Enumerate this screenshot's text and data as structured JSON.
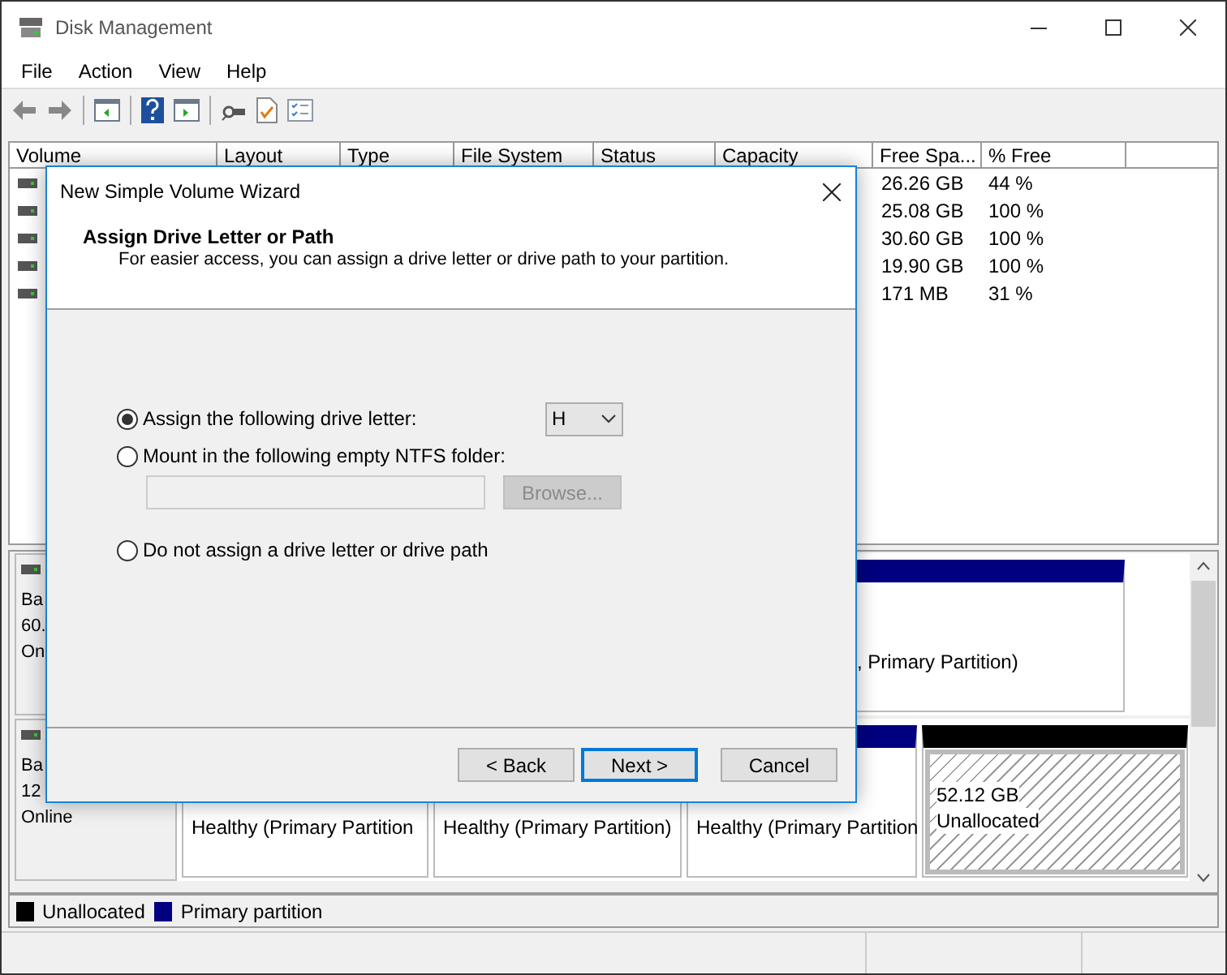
{
  "window": {
    "title": "Disk Management"
  },
  "menu": [
    "File",
    "Action",
    "View",
    "Help"
  ],
  "volume_table": {
    "columns": [
      "Volume",
      "Layout",
      "Type",
      "File System",
      "Status",
      "Capacity",
      "Free Spa...",
      "% Free"
    ],
    "rows": [
      {
        "free_space": "26.26 GB",
        "percent_free": "44 %"
      },
      {
        "free_space": "25.08 GB",
        "percent_free": "100 %"
      },
      {
        "free_space": "30.60 GB",
        "percent_free": "100 %"
      },
      {
        "free_space": "19.90 GB",
        "percent_free": "100 %"
      },
      {
        "free_space": "171 MB",
        "percent_free": "31 %"
      }
    ]
  },
  "disks": [
    {
      "label_lines": [
        "Ba",
        "60.",
        "On"
      ],
      "partitions": [
        {
          "kind": "primary",
          "lines": [
            ", Primary Partition)"
          ]
        }
      ]
    },
    {
      "label_lines": [
        "Ba",
        "12",
        "Online"
      ],
      "partitions": [
        {
          "kind": "primary",
          "lines": [
            "Healthy (Primary Partition"
          ]
        },
        {
          "kind": "primary",
          "lines": [
            "Healthy (Primary Partition)"
          ]
        },
        {
          "kind": "primary",
          "lines": [
            "Healthy (Primary Partition"
          ]
        },
        {
          "kind": "unallocated",
          "lines": [
            "52.12 GB",
            "Unallocated"
          ]
        }
      ]
    }
  ],
  "legend": [
    {
      "label": "Unallocated",
      "color": "#000000"
    },
    {
      "label": "Primary partition",
      "color": "#000080"
    }
  ],
  "dialog": {
    "title": "New Simple Volume Wizard",
    "heading": "Assign Drive Letter or Path",
    "description": "For easier access, you can assign a drive letter or drive path to your partition.",
    "options": [
      {
        "kind": "letter",
        "label": "Assign the following drive letter:",
        "selected": true
      },
      {
        "kind": "folder",
        "label": "Mount in the following empty NTFS folder:",
        "selected": false
      },
      {
        "kind": "none",
        "label": "Do not assign a drive letter or drive path",
        "selected": false
      }
    ],
    "drive_letter": "H",
    "folder_field": {
      "disabled": true
    },
    "browse": {
      "label": "Browse...",
      "disabled": true
    },
    "buttons": [
      {
        "label": "< Back",
        "focused": false
      },
      {
        "label": "Next >",
        "focused": true
      },
      {
        "label": "Cancel",
        "focused": false
      }
    ]
  }
}
